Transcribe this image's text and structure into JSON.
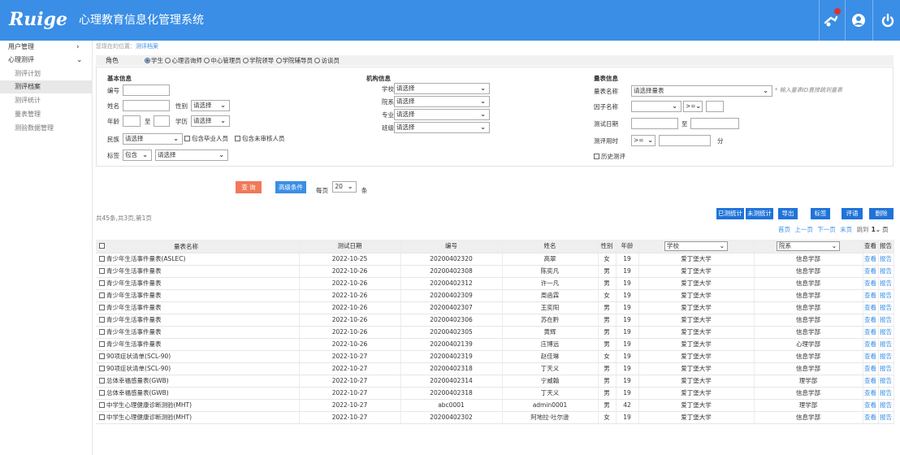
{
  "header": {
    "logo": "Ruige",
    "title": "心理教育信息化管理系统",
    "icons": [
      "notification-icon",
      "user-icon",
      "power-icon"
    ]
  },
  "sidebar": {
    "items": [
      {
        "label": "用户管理",
        "arrow": "›"
      },
      {
        "label": "心理测评",
        "arrow": "⌄"
      }
    ],
    "subitems": [
      "测评计划",
      "测评档案",
      "测评统计",
      "量表管理",
      "测验数据管理"
    ]
  },
  "breadcrumb": {
    "prefix": "您现在的位置：",
    "current": "测评档案"
  },
  "role": {
    "label": "角色",
    "options": [
      "学生",
      "心理咨询师",
      "中心管理员",
      "学院领导",
      "学院辅导员",
      "访谈员"
    ],
    "selected": "学生"
  },
  "basic": {
    "title": "基本信息",
    "id_label": "编号",
    "name_label": "姓名",
    "gender_label": "性别",
    "gender_value": "请选择",
    "age_label": "年龄",
    "to_label": "至",
    "edu_label": "学历",
    "edu_value": "请选择",
    "nation_label": "民族",
    "nation_value": "请选择",
    "check_grad": "包含毕业人员",
    "check_unreviewed": "包含未审核人员",
    "tag_label": "标签",
    "tag_mode": "包含",
    "tag_value": "请选择"
  },
  "org": {
    "title": "机构信息",
    "school_label": "学校",
    "school_value": "请选择",
    "dept_label": "院系",
    "dept_value": "请选择",
    "major_label": "专业",
    "major_value": "请选择",
    "class_label": "班级",
    "class_value": "请选择"
  },
  "scale": {
    "title": "量表信息",
    "name_label": "量表名称",
    "name_value": "请选择量表",
    "hint": "* 输入量表ID直接跳到量表",
    "factor_label": "因子名称",
    "factor_op": ">=",
    "date_label": "测试日期",
    "date_to": "至",
    "time_label": "测评用时",
    "time_op": ">=",
    "time_unit": "分",
    "history": "历史测评"
  },
  "actions": {
    "query": "查 询",
    "advanced": "高级条件",
    "perpage_prefix": "每页",
    "perpage_value": "20",
    "perpage_suffix": "条"
  },
  "summary": "共45条,共3页,第1页",
  "toolbar": [
    "已测统计",
    "未测统计",
    "导出",
    "标签",
    "评语",
    "删除"
  ],
  "pager": {
    "first": "首页",
    "prev": "上一页",
    "next": "下一页",
    "last": "末页",
    "jump": "跳到",
    "page": "1",
    "unit": "页"
  },
  "table": {
    "headers": {
      "scale": "量表名称",
      "date": "测试日期",
      "id": "编号",
      "name": "姓名",
      "gender": "性别",
      "age": "年龄",
      "school": "学校",
      "dept": "院系",
      "view": "查看",
      "report": "报告"
    },
    "view_label": "查看",
    "report_label": "报告",
    "rows": [
      [
        "青少年生活事件量表(ASLEC)",
        "2022-10-25",
        "20200402320",
        "高翠",
        "女",
        "19",
        "爱丁堡大学",
        "信息学部"
      ],
      [
        "青少年生活事件量表",
        "2022-10-26",
        "20200402308",
        "陈奕凡",
        "男",
        "19",
        "爱丁堡大学",
        "信息学部"
      ],
      [
        "青少年生活事件量表",
        "2022-10-26",
        "20200402312",
        "许一凡",
        "男",
        "19",
        "爱丁堡大学",
        "信息学部"
      ],
      [
        "青少年生活事件量表",
        "2022-10-26",
        "20200402309",
        "周函霖",
        "女",
        "19",
        "爱丁堡大学",
        "信息学部"
      ],
      [
        "青少年生活事件量表",
        "2022-10-26",
        "20200402307",
        "王奕阳",
        "男",
        "19",
        "爱丁堡大学",
        "信息学部"
      ],
      [
        "青少年生活事件量表",
        "2022-10-26",
        "20200402306",
        "苏在黔",
        "男",
        "19",
        "爱丁堡大学",
        "信息学部"
      ],
      [
        "青少年生活事件量表",
        "2022-10-26",
        "20200402305",
        "黄辉",
        "男",
        "19",
        "爱丁堡大学",
        "信息学部"
      ],
      [
        "青少年生活事件量表",
        "2022-10-26",
        "20200402139",
        "庄博远",
        "男",
        "19",
        "爱丁堡大学",
        "心理学部"
      ],
      [
        "90项症状清单(SCL-90)",
        "2022-10-27",
        "20200402319",
        "赵佳琳",
        "女",
        "19",
        "爱丁堡大学",
        "信息学部"
      ],
      [
        "90项症状清单(SCL-90)",
        "2022-10-27",
        "20200402318",
        "丁天义",
        "男",
        "19",
        "爱丁堡大学",
        "信息学部"
      ],
      [
        "总体幸福感量表(GWB)",
        "2022-10-27",
        "20200402314",
        "宁威翰",
        "男",
        "19",
        "爱丁堡大学",
        "理学部"
      ],
      [
        "总体幸福感量表(GWB)",
        "2022-10-27",
        "20200402318",
        "丁天义",
        "男",
        "19",
        "爱丁堡大学",
        "信息学部"
      ],
      [
        "中学生心理健康诊断测验(MHT)",
        "2022-10-27",
        "abc0001",
        "admin0001",
        "男",
        "42",
        "爱丁堡大学",
        "理学部"
      ],
      [
        "中学生心理健康诊断测验(MHT)",
        "2022-10-27",
        "20200402302",
        "阿地拉·吐尔逊",
        "女",
        "19",
        "爱丁堡大学",
        "信息学部"
      ]
    ]
  }
}
